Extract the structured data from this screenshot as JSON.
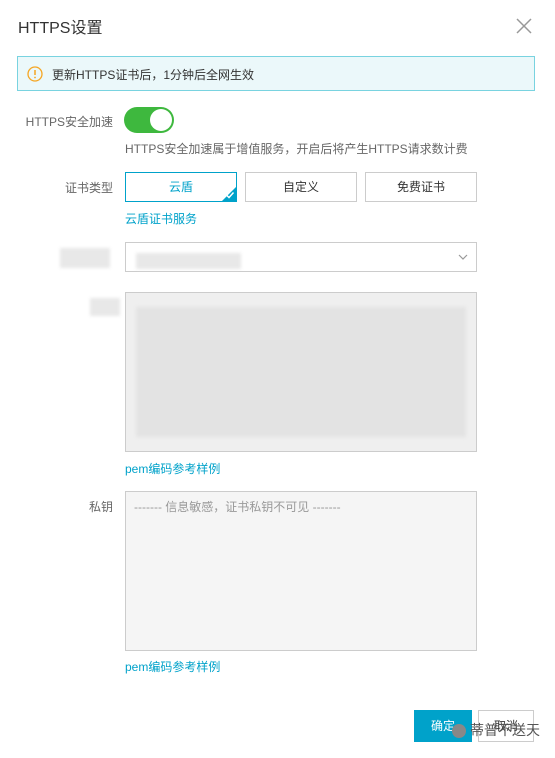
{
  "dialog": {
    "title": "HTTPS设置"
  },
  "notice": {
    "text": "更新HTTPS证书后，1分钟后全网生效"
  },
  "https_acceleration": {
    "label": "HTTPS安全加速",
    "enabled": true,
    "hint": "HTTPS安全加速属于增值服务，开启后将产生HTTPS请求数计费"
  },
  "certificate_type": {
    "label": "证书类型",
    "options": [
      "云盾",
      "自定义",
      "免费证书"
    ],
    "selected": "云盾",
    "service_link": "云盾证书服务"
  },
  "certificate": {
    "pem_link": "pem编码参考样例"
  },
  "private_key": {
    "label": "私钥",
    "placeholder": "------- 信息敏感，证书私钥不可见 -------",
    "pem_link": "pem编码参考样例"
  },
  "footer": {
    "confirm": "确定",
    "cancel": "取消",
    "watermark": "蒂普不送天"
  },
  "colors": {
    "accent": "#00a2ca",
    "switch_on": "#3eb83e",
    "notice_bg": "#ebf8fa",
    "notice_border": "#79d3e0",
    "warning_icon": "#f5a623"
  }
}
